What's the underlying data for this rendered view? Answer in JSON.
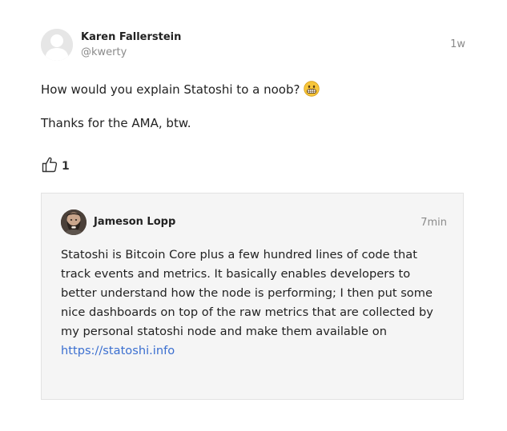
{
  "post": {
    "author_name": "Karen Fallerstein",
    "author_handle": "@kwerty",
    "time": "1w",
    "text_line1": "How would you explain Statoshi to a noob?",
    "emoji_icon": "grinning-face-icon",
    "text_line2": "Thanks for the AMA, btw.",
    "like_icon": "thumbs-up-icon",
    "like_count": "1"
  },
  "reply": {
    "author_name": "Jameson Lopp",
    "time": "7min",
    "lines": [
      "Statoshi is Bitcoin Core plus a few hundred lines of code that",
      "track events and metrics. It basically enables developers to",
      "better understand how the node is performing; I then put some",
      "nice dashboards on top of the raw metrics that are collected by",
      "my personal statoshi node and make them available on"
    ],
    "link_text": "https://statoshi.info"
  },
  "colors": {
    "link": "#3b6fd0",
    "muted": "#8a8a8a",
    "reply_background": "#f5f5f5"
  }
}
